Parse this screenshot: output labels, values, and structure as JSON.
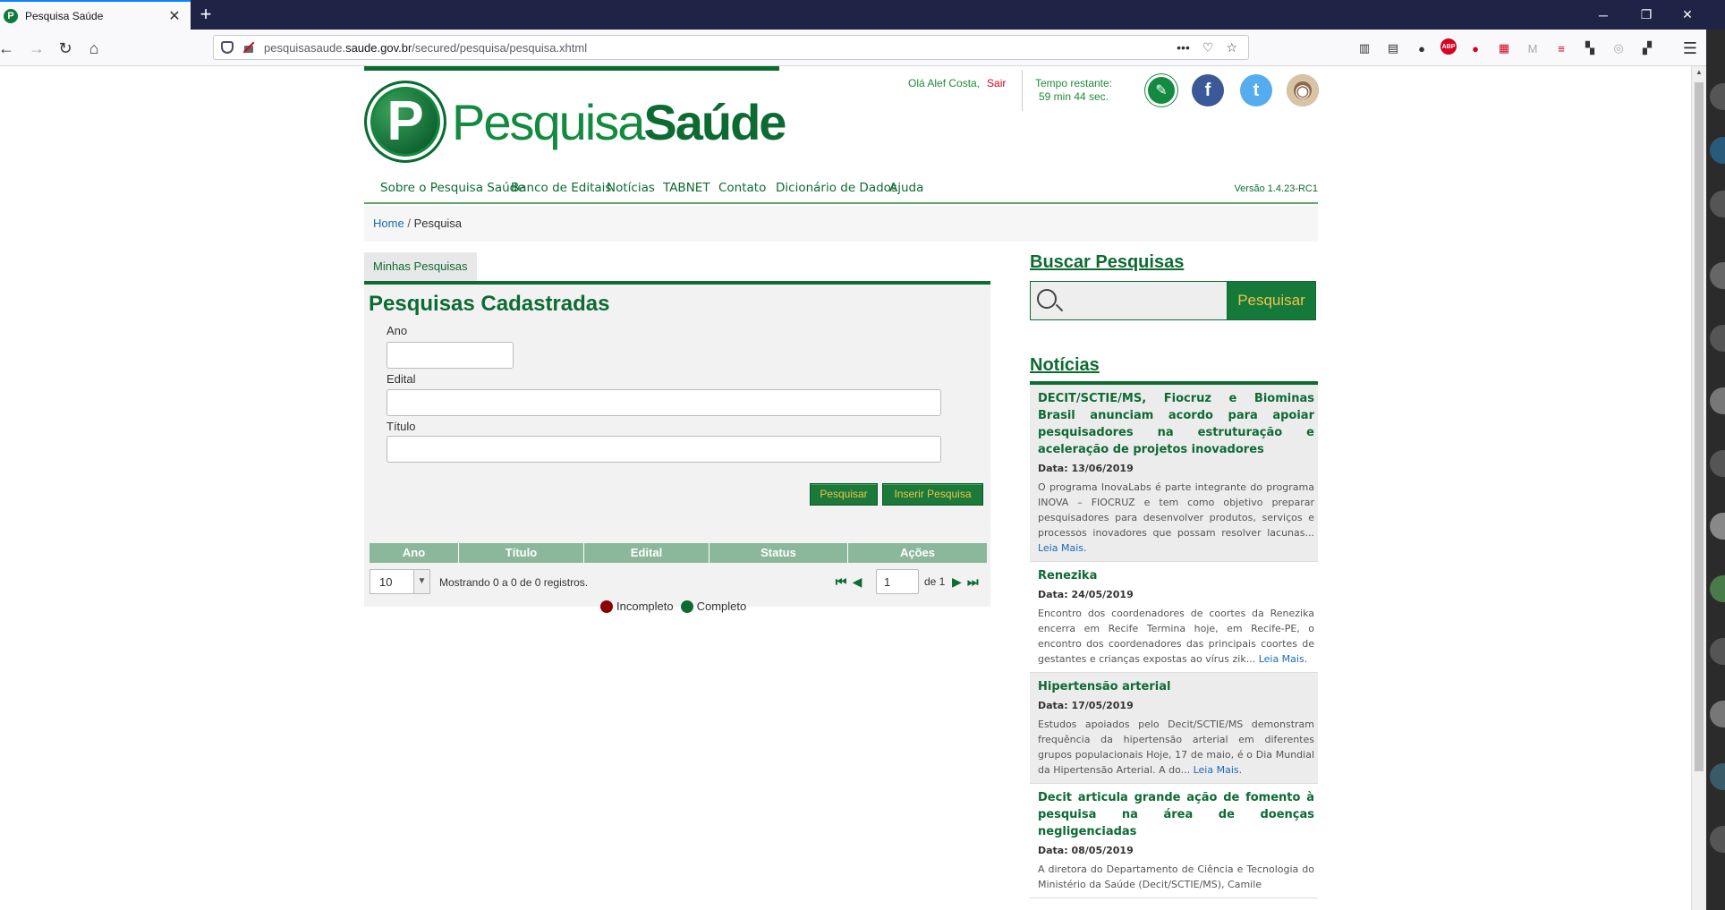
{
  "browser": {
    "tab_title": "Pesquisa Saúde",
    "tab_favicon_letter": "P",
    "url_prefix": "pesquisasaude.",
    "url_host": "saude.gov.br",
    "url_path": "/secured/pesquisa/pesquisa.xhtml"
  },
  "header": {
    "logo_letter": "P",
    "logo_text_regular": "Pesquisa",
    "logo_text_bold": "Saúde",
    "greeting": "Olá Alef Costa,",
    "logout": "Sair",
    "timer_label": "Tempo restante:",
    "timer_value": "59 min 44 sec."
  },
  "nav": {
    "items": [
      "Sobre o Pesquisa Saúde",
      "Banco de Editais",
      "Notícias",
      "TABNET",
      "Contato",
      "Dicionário de Dados",
      "Ajuda"
    ],
    "version": "Versão 1.4.23-RC1"
  },
  "breadcrumb": {
    "home": "Home",
    "separator": "/",
    "current": "Pesquisa"
  },
  "left": {
    "tab": "Minhas Pesquisas",
    "title": "Pesquisas Cadastradas",
    "fields": {
      "ano": "Ano",
      "edital": "Edital",
      "titulo": "Título"
    },
    "buttons": {
      "search": "Pesquisar",
      "insert": "Inserir Pesquisa"
    },
    "columns": [
      "Ano",
      "Título",
      "Edital",
      "Status",
      "Ações"
    ],
    "page_size": "10",
    "records": "Mostrando 0 a 0 de 0 registros.",
    "page": "1",
    "page_of": "de 1",
    "legend": {
      "incomplete": "Incompleto",
      "complete": "Completo"
    }
  },
  "right": {
    "search_title": "Buscar Pesquisas",
    "search_button": "Pesquisar",
    "news_title": "Notícias",
    "more": "Leia Mais.",
    "news": [
      {
        "title": "DECIT/SCTIE/MS, Fiocruz e Biominas Brasil anunciam acordo para apoiar pesquisadores na estruturação e aceleração de projetos inovadores",
        "date": "Data: 13/06/2019",
        "body": "O programa InovaLabs é parte integrante do programa INOVA – FIOCRUZ e tem como objetivo preparar pesquisadores para desenvolver produtos, serviços e processos inovadores que possam resolver lacunas..."
      },
      {
        "title": "Renezika",
        "date": "Data: 24/05/2019",
        "body": "Encontro dos coordenadores de coortes da Renezika encerra em Recife Termina hoje, em Recife-PE, o encontro dos coordenadores das principais coortes de gestantes e crianças expostas ao vírus zik..."
      },
      {
        "title": "Hipertensão arterial",
        "date": "Data: 17/05/2019",
        "body": "Estudos apoiados pelo Decit/SCTIE/MS demonstram frequência da hipertensão arterial em diferentes grupos populacionais     Hoje, 17 de maio, é o Dia Mundial da Hipertensão Arterial. A do..."
      },
      {
        "title": "Decit articula grande ação de fomento à pesquisa na área de doenças negligenciadas",
        "date": "Data: 08/05/2019",
        "body": "A diretora do Departamento de Ciência e Tecnologia do Ministério da Saúde (Decit/SCTIE/MS), Camile"
      }
    ]
  },
  "colors": {
    "brand_green": "#0d6b32",
    "accent_yellow": "#f1c24a",
    "incomplete": "#8b0000",
    "complete": "#0d6b32"
  }
}
